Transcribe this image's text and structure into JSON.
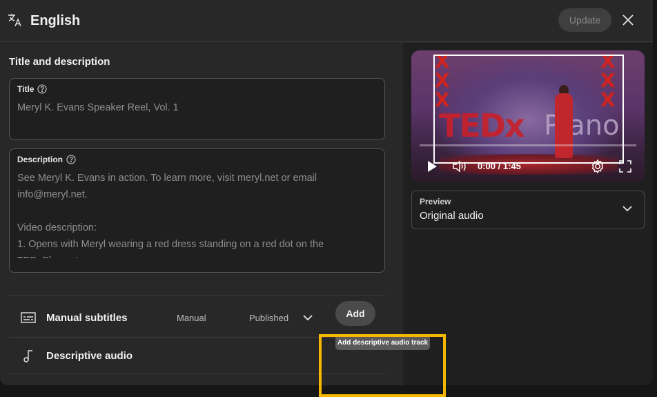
{
  "header": {
    "title": "English",
    "update_label": "Update",
    "lang_icon": "translate-icon",
    "close_icon": "close-icon"
  },
  "left": {
    "section_title": "Title and description",
    "title_field": {
      "label": "Title",
      "value": "Meryl K. Evans Speaker Reel, Vol. 1"
    },
    "description_field": {
      "label": "Description",
      "lines": [
        "See Meryl K. Evans in action. To learn more, visit meryl.net or email",
        "info@meryl.net.",
        "",
        "Video description:",
        "1. Opens with Meryl wearing a red dress standing on a red dot on the",
        "TEDxPlano stage."
      ]
    },
    "rows": [
      {
        "label": "Manual subtitles",
        "type": "Manual",
        "status": "Published",
        "icon": "subtitles-icon"
      },
      {
        "label": "Descriptive audio",
        "icon": "music-note-icon",
        "add_label": "Add",
        "tooltip": "Add descriptive audio track"
      }
    ]
  },
  "video": {
    "time": "0:00 / 1:45",
    "stage_text_1": "TEDx",
    "stage_text_2": "Plano"
  },
  "preview": {
    "label": "Preview",
    "value": "Original audio"
  },
  "colors": {
    "highlight": "#f5b700",
    "dialog_bg": "#282828",
    "panel_bg": "#1f1f1f"
  }
}
